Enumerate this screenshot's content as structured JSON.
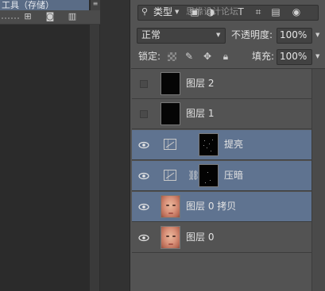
{
  "left_panel": {
    "tab_title": "工具（存储）",
    "toolbar_icons": [
      "new-item-icon",
      "camera-icon",
      "trash-icon"
    ]
  },
  "layers_panel": {
    "filter": {
      "kind_label": "类型",
      "overlay_text": "思缘设计论坛"
    },
    "blend_mode": "正常",
    "opacity_label": "不透明度:",
    "opacity_value": "100%",
    "lock_label": "锁定:",
    "fill_label": "填充:",
    "fill_value": "100%",
    "layers": [
      {
        "name": "图层 2",
        "visible": false,
        "selected": false,
        "type": "pixel-black"
      },
      {
        "name": "图层 1",
        "visible": false,
        "selected": false,
        "type": "pixel-black"
      },
      {
        "name": "提亮",
        "visible": true,
        "selected": true,
        "type": "curves-adjustment"
      },
      {
        "name": "压暗",
        "visible": true,
        "selected": true,
        "type": "curves-adjustment-linked"
      },
      {
        "name": "图层 0 拷贝",
        "visible": true,
        "selected": true,
        "type": "pixel-face"
      },
      {
        "name": "图层 0",
        "visible": true,
        "selected": false,
        "type": "pixel-face"
      }
    ]
  },
  "colors": {
    "panel_bg": "#535353",
    "selection": "#5f7390",
    "dark_bg": "#2b2b2b"
  }
}
